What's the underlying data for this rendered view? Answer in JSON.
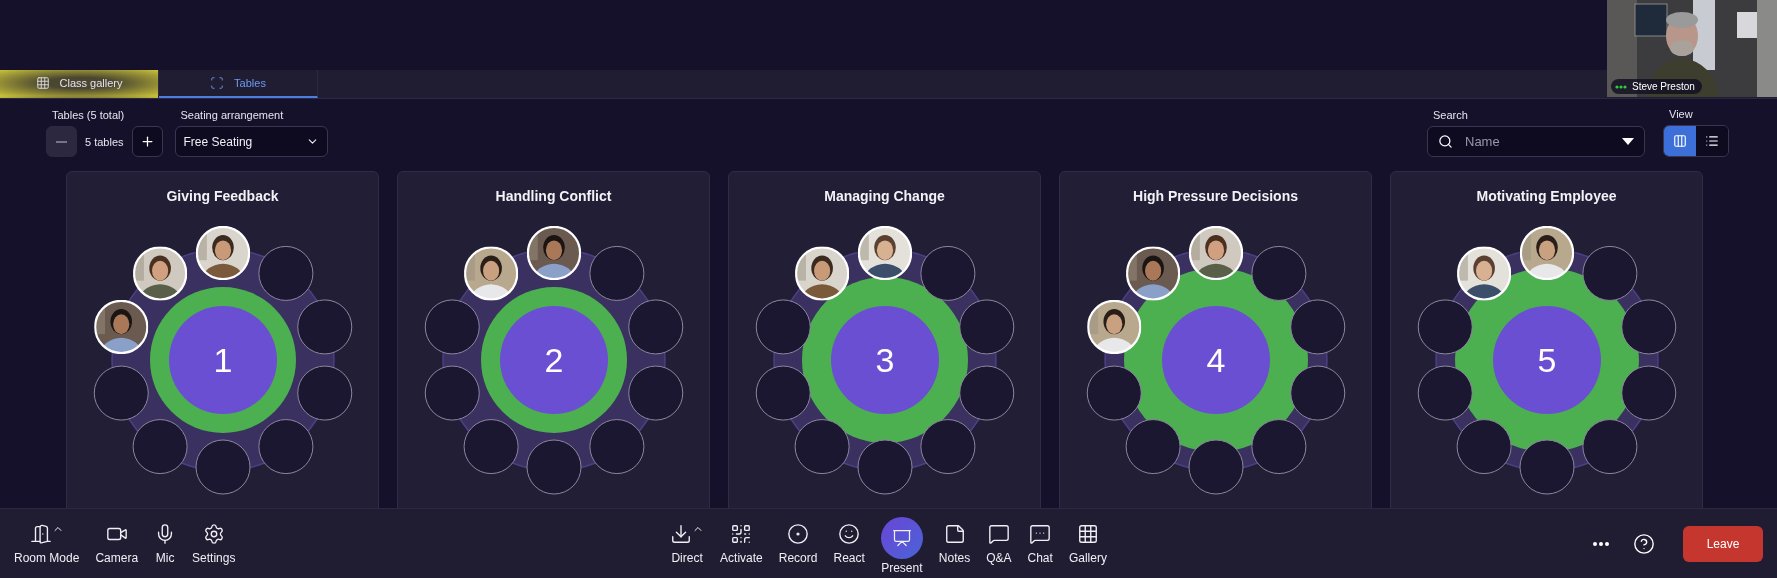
{
  "video_tile": {
    "name": "Steve Preston",
    "kind": "picture"
  },
  "tabs": [
    {
      "label": "Class gallery",
      "selected": false,
      "highlighted": true
    },
    {
      "label": "Tables",
      "selected": true,
      "highlighted": false
    }
  ],
  "table_count": {
    "label": "Tables (5 total)",
    "value": "5 tables"
  },
  "seating": {
    "label": "Seating arrangement",
    "value": "Free Seating"
  },
  "search": {
    "label": "Search",
    "placeholder": "Name"
  },
  "view": {
    "label": "View",
    "options": [
      {
        "kind": "grid",
        "selected": true
      },
      {
        "kind": "list",
        "selected": false
      }
    ]
  },
  "tables": [
    {
      "title": "Giving Feedback",
      "number": "1",
      "kind": "ring",
      "seats": [
        {
          "occupied": true
        },
        {
          "occupied": false
        },
        {
          "occupied": false
        },
        {
          "occupied": false
        },
        {
          "occupied": false
        },
        {
          "occupied": false
        },
        {
          "occupied": false
        },
        {
          "occupied": false
        },
        {
          "occupied": true
        },
        {
          "occupied": true
        }
      ]
    },
    {
      "title": "Handling Conflict",
      "number": "2",
      "kind": "ring",
      "seats": [
        {
          "occupied": true
        },
        {
          "occupied": false
        },
        {
          "occupied": false
        },
        {
          "occupied": false
        },
        {
          "occupied": false
        },
        {
          "occupied": false
        },
        {
          "occupied": false
        },
        {
          "occupied": false
        },
        {
          "occupied": false
        },
        {
          "occupied": true
        }
      ]
    },
    {
      "title": "Managing Change",
      "number": "3",
      "kind": "disc",
      "seats": [
        {
          "occupied": true
        },
        {
          "occupied": false
        },
        {
          "occupied": false
        },
        {
          "occupied": false
        },
        {
          "occupied": false
        },
        {
          "occupied": false
        },
        {
          "occupied": false
        },
        {
          "occupied": false
        },
        {
          "occupied": false
        },
        {
          "occupied": true
        }
      ]
    },
    {
      "title": "High Pressure Decisions",
      "number": "4",
      "kind": "full",
      "seats": [
        {
          "occupied": true
        },
        {
          "occupied": false
        },
        {
          "occupied": false
        },
        {
          "occupied": false
        },
        {
          "occupied": false
        },
        {
          "occupied": false
        },
        {
          "occupied": false
        },
        {
          "occupied": false
        },
        {
          "occupied": true
        },
        {
          "occupied": true
        }
      ]
    },
    {
      "title": "Motivating Employee",
      "number": "5",
      "kind": "full",
      "seats": [
        {
          "occupied": true
        },
        {
          "occupied": false
        },
        {
          "occupied": false
        },
        {
          "occupied": false
        },
        {
          "occupied": false
        },
        {
          "occupied": false
        },
        {
          "occupied": false
        },
        {
          "occupied": false
        },
        {
          "occupied": false
        },
        {
          "occupied": true
        }
      ]
    }
  ],
  "toolbar_left": [
    {
      "label": "Room Mode",
      "menu": true
    },
    {
      "label": "Camera",
      "menu": false
    },
    {
      "label": "Mic",
      "menu": false
    },
    {
      "label": "Settings",
      "menu": false
    }
  ],
  "toolbar_center": [
    {
      "label": "Direct",
      "kind": "tool",
      "menu": true
    },
    {
      "label": "Activate",
      "kind": "tool",
      "menu": false
    },
    {
      "label": "Record",
      "kind": "tool",
      "menu": false
    },
    {
      "label": "React",
      "kind": "tool",
      "menu": false
    },
    {
      "label": "Present",
      "kind": "primary"
    },
    {
      "label": "Notes",
      "kind": "tool",
      "menu": false
    },
    {
      "label": "Q&A",
      "kind": "tool",
      "menu": false
    },
    {
      "label": "Chat",
      "kind": "tool",
      "menu": false
    },
    {
      "label": "Gallery",
      "kind": "tool",
      "menu": false
    }
  ],
  "leave_button": "Leave"
}
